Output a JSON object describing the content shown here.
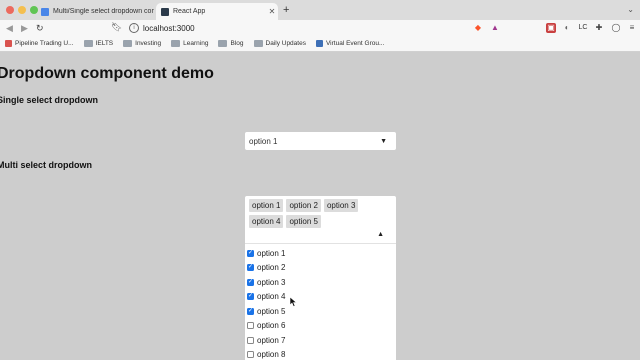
{
  "browser": {
    "tabs": [
      {
        "title": "Multi/Single select dropdown comp",
        "active": false
      },
      {
        "title": "React App",
        "active": true
      }
    ],
    "url": "localhost:3000",
    "bookmarks": [
      {
        "label": "Pipeline Trading U...",
        "icon": "pipeline-favicon-icon"
      },
      {
        "label": "IELTS",
        "icon": "folder-icon"
      },
      {
        "label": "Investing",
        "icon": "folder-icon"
      },
      {
        "label": "Learning",
        "icon": "folder-icon"
      },
      {
        "label": "Blog",
        "icon": "folder-icon"
      },
      {
        "label": "Daily Updates",
        "icon": "folder-icon"
      },
      {
        "label": "Virtual Event Grou...",
        "icon": "virtual-event-favicon-icon"
      }
    ]
  },
  "page": {
    "title": "Dropdown component demo",
    "single_section_title": "Single select dropdown",
    "multi_section_title": "Multi select dropdown",
    "single_select": {
      "value": "option 1"
    },
    "multi_select": {
      "selected": [
        "option 1",
        "option 2",
        "option 3",
        "option 4",
        "option 5"
      ],
      "options": [
        {
          "label": "option 1",
          "checked": true
        },
        {
          "label": "option 2",
          "checked": true
        },
        {
          "label": "option 3",
          "checked": true
        },
        {
          "label": "option 4",
          "checked": true
        },
        {
          "label": "option 5",
          "checked": true
        },
        {
          "label": "option 6",
          "checked": false
        },
        {
          "label": "option 7",
          "checked": false
        },
        {
          "label": "option 8",
          "checked": false
        }
      ]
    }
  },
  "colors": {
    "page_bg": "#cdcdcd",
    "checkbox_accent": "#1a73e8",
    "chip_bg": "#dcdcdc"
  }
}
